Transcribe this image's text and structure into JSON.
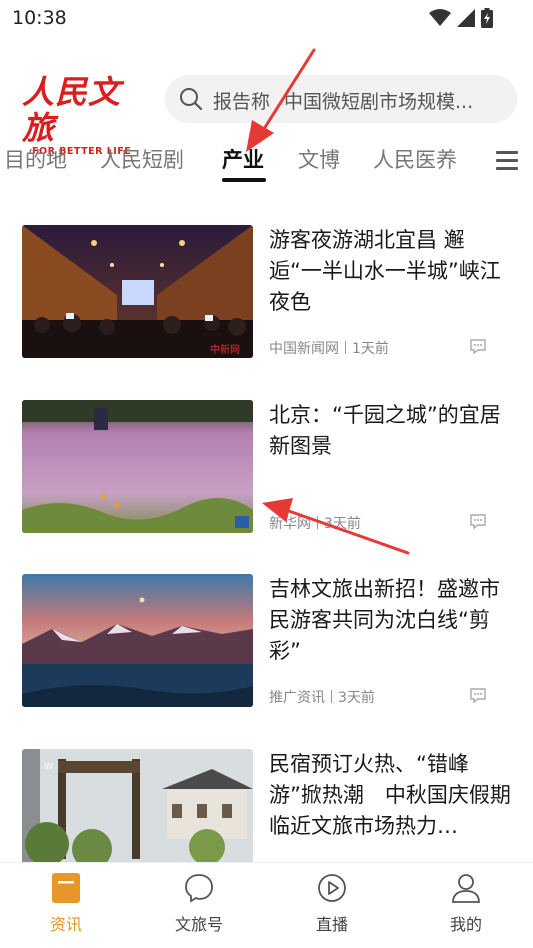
{
  "status_bar": {
    "time": "10:38",
    "icons": [
      "wifi-icon",
      "signal-icon",
      "battery-charging-icon"
    ]
  },
  "header": {
    "logo_cn": "人民文旅",
    "logo_en": "FOR BETTER LIFE",
    "search_left": "报告称",
    "search_right": "中国微短剧市场规模..."
  },
  "tabs": [
    {
      "label": "目的地",
      "active": false
    },
    {
      "label": "人民短剧",
      "active": false
    },
    {
      "label": "产业",
      "active": true
    },
    {
      "label": "文博",
      "active": false
    },
    {
      "label": "人民医养",
      "active": false
    }
  ],
  "articles": [
    {
      "title": "游客夜游湖北宜昌 邂逅“一半山水一半城”峡江夜色",
      "source": "中国新闻网",
      "time": "1天前",
      "watermark": "中新网"
    },
    {
      "title": "北京：“千园之城”的宜居新图景",
      "source": "新华网",
      "time": "3天前"
    },
    {
      "title": "吉林文旅出新招！盛邀市民游客共同为沈白线“剪彩”",
      "source": "推广资讯",
      "time": "3天前"
    },
    {
      "title": "民宿预订火热、“错峰游”掀热潮　中秋国庆假期临近文旅市场热力…",
      "source": "",
      "time": ""
    }
  ],
  "bottom_nav": [
    {
      "label": "资讯",
      "icon": "news-icon",
      "active": true
    },
    {
      "label": "文旅号",
      "icon": "chat-bubble-icon",
      "active": false
    },
    {
      "label": "直播",
      "icon": "play-circle-icon",
      "active": false
    },
    {
      "label": "我的",
      "icon": "user-icon",
      "active": false
    }
  ],
  "colors": {
    "brand_red": "#d81e1e",
    "active_orange": "#e8962a",
    "annotation_red": "#e53935"
  }
}
